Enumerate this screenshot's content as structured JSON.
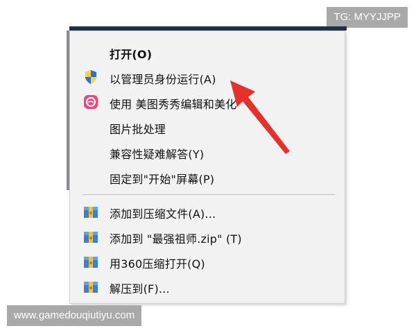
{
  "watermarks": {
    "top_right": "TG: MYYJJPP",
    "bottom_left": "www.gamedouqiutiyu.com"
  },
  "context_menu": {
    "items": [
      {
        "label": "打开(O)",
        "icon": null
      },
      {
        "label": "以管理员身份运行(A)",
        "icon": "uac-shield-icon"
      },
      {
        "label": "使用 美图秀秀编辑和美化",
        "icon": "meitu-xiuxiu-icon"
      },
      {
        "label": "图片批处理",
        "icon": null
      },
      {
        "label": "兼容性疑难解答(Y)",
        "icon": null
      },
      {
        "label": "固定到\"开始\"屏幕(P)",
        "icon": null
      },
      {
        "label": "添加到压缩文件(A)...",
        "icon": "archive-icon"
      },
      {
        "label": "添加到 \"最强祖师.zip\" (T)",
        "icon": "archive-icon"
      },
      {
        "label": "用360压缩打开(Q)",
        "icon": "archive-icon"
      },
      {
        "label": "解压到(F)...",
        "icon": "archive-icon"
      }
    ]
  },
  "colors": {
    "menu_bg": "#f2f2f2",
    "arrow": "#e8302a",
    "window_strip": "#1e3247"
  }
}
